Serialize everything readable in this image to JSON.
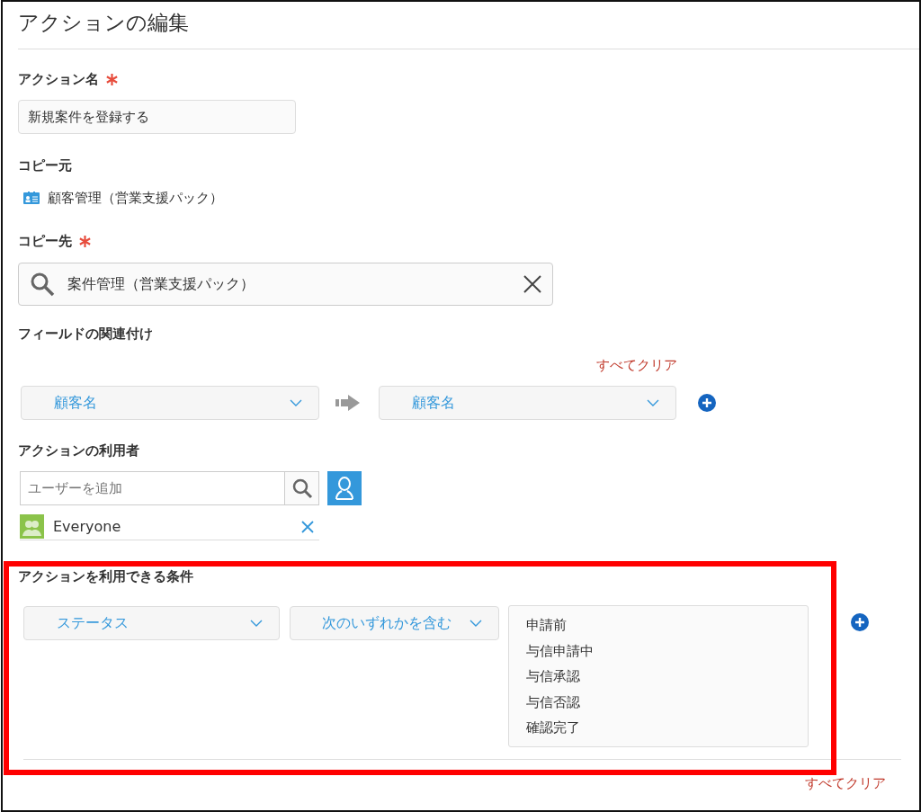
{
  "title": "アクションの編集",
  "action_name": {
    "label": "アクション名",
    "required": true,
    "value": "新規案件を登録する"
  },
  "source": {
    "label": "コピー元",
    "app": "顧客管理（営業支援パック）"
  },
  "destination": {
    "label": "コピー先",
    "required": true,
    "value": "案件管理（営業支援パック）"
  },
  "field_mapping": {
    "label": "フィールドの関連付け",
    "clear_all": "すべてクリア",
    "rows": [
      {
        "from": "顧客名",
        "to": "顧客名"
      }
    ]
  },
  "users": {
    "label": "アクションの利用者",
    "placeholder": "ユーザーを追加",
    "entries": [
      {
        "name": "Everyone"
      }
    ]
  },
  "conditions": {
    "label": "アクションを利用できる条件",
    "rows": [
      {
        "field": "ステータス",
        "operator": "次のいずれかを含む",
        "values": [
          "申請前",
          "与信申請中",
          "与信承認",
          "与信否認",
          "確認完了"
        ]
      }
    ],
    "clear_all": "すべてクリア"
  }
}
